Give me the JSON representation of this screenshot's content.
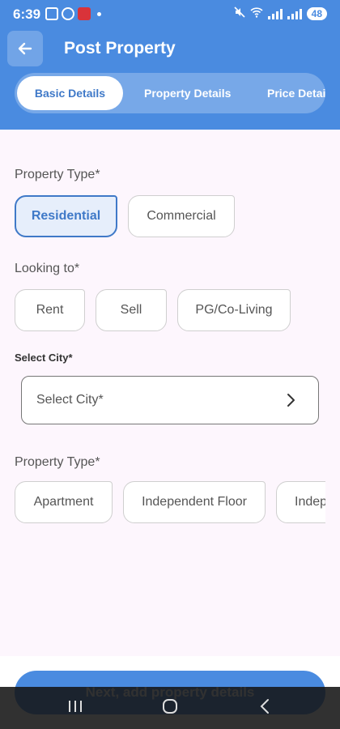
{
  "status_bar": {
    "time": "6:39",
    "battery": "48"
  },
  "header": {
    "title": "Post Property",
    "tabs": [
      {
        "label": "Basic Details",
        "active": true
      },
      {
        "label": "Property Details",
        "active": false
      },
      {
        "label": "Price Detail",
        "active": false
      }
    ]
  },
  "property_type_section": {
    "label": "Property Type*",
    "options": [
      {
        "label": "Residential",
        "selected": true
      },
      {
        "label": "Commercial",
        "selected": false
      }
    ]
  },
  "looking_to_section": {
    "label": "Looking to*",
    "options": [
      {
        "label": "Rent"
      },
      {
        "label": "Sell"
      },
      {
        "label": "PG/Co-Living"
      }
    ]
  },
  "city_section": {
    "label": "Select City*",
    "placeholder": "Select City*"
  },
  "property_subtype_section": {
    "label": "Property Type*",
    "options": [
      {
        "label": "Apartment"
      },
      {
        "label": "Independent Floor"
      },
      {
        "label": "Indep"
      }
    ]
  },
  "footer": {
    "next_button": "Next, add property details"
  },
  "colors": {
    "primary": "#4a8be0",
    "primary_dark": "#3f79c8",
    "background": "#fdf6fd",
    "selected_fill": "#e6eefb"
  }
}
